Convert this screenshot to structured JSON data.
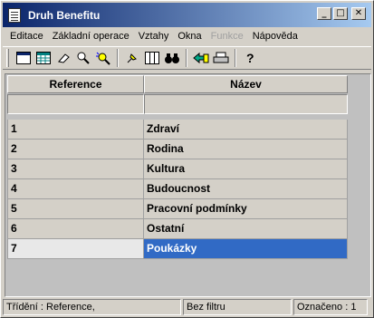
{
  "window": {
    "title": "Druh Benefitu"
  },
  "title_buttons": {
    "minimize": "_",
    "maximize": "□",
    "close": "✕"
  },
  "menu": [
    "Editace",
    "Základní operace",
    "Vztahy",
    "Okna",
    "Funkce",
    "Nápověda"
  ],
  "menu_disabled": [
    "Funkce"
  ],
  "toolbar": [
    "window-icon",
    "table-icon",
    "eraser-icon",
    "search-icon",
    "magic-search-icon",
    "pin-icon",
    "columns-icon",
    "binoculars-icon",
    "export-icon",
    "print-icon",
    "help-icon"
  ],
  "grid": {
    "headers": {
      "reference": "Reference",
      "name": "Název"
    },
    "rows": [
      {
        "ref": "1",
        "name": "Zdraví"
      },
      {
        "ref": "2",
        "name": "Rodina"
      },
      {
        "ref": "3",
        "name": "Kultura"
      },
      {
        "ref": "4",
        "name": "Budoucnost"
      },
      {
        "ref": "5",
        "name": "Pracovní podmínky"
      },
      {
        "ref": "6",
        "name": "Ostatní"
      },
      {
        "ref": "7",
        "name": "Poukázky"
      }
    ],
    "selected_index": 6,
    "selection_color": "#316ac5"
  },
  "status": {
    "sort": "Třídění : Reference,",
    "filter": "Bez filtru",
    "marked": "Označeno : 1"
  }
}
